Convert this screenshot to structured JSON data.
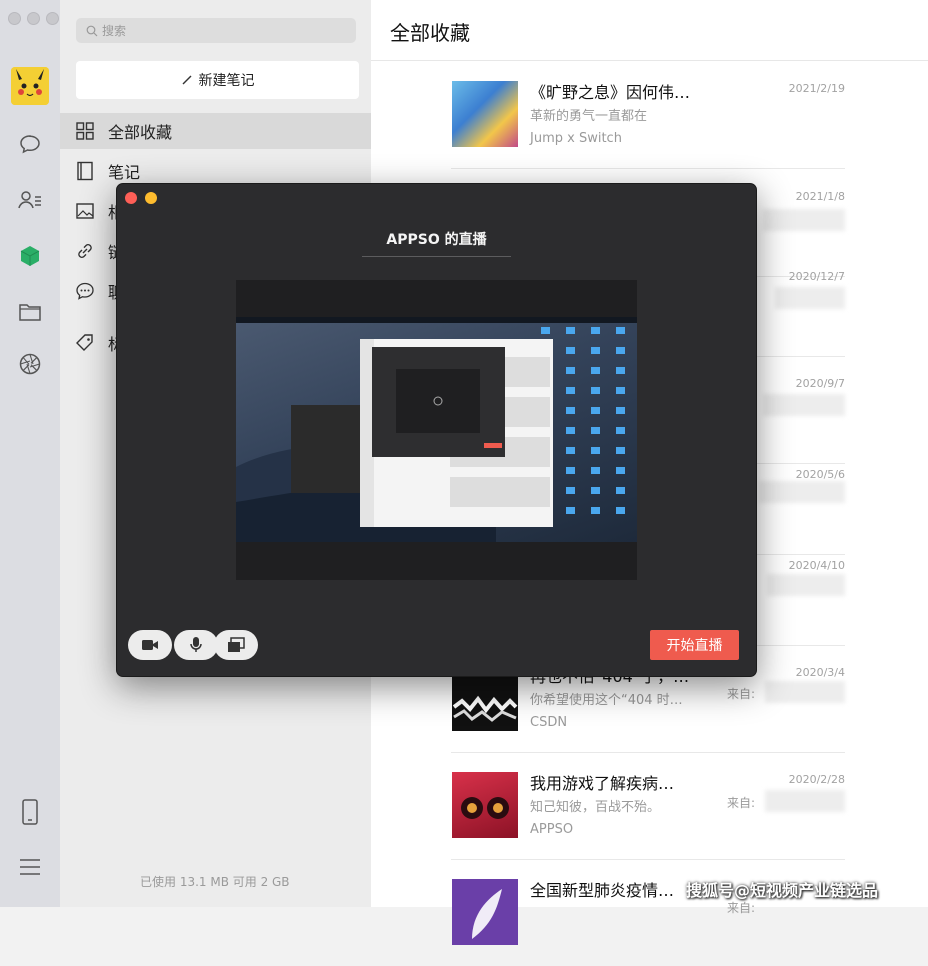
{
  "sidebar": {
    "search_placeholder": "搜索",
    "new_note_label": "新建笔记",
    "items": [
      {
        "label": "全部收藏",
        "icon": "grid-icon"
      },
      {
        "label": "笔记",
        "icon": "notebook-icon"
      },
      {
        "label": "相",
        "icon": "image-icon"
      },
      {
        "label": "链",
        "icon": "link-icon"
      },
      {
        "label": "聊",
        "icon": "chat-icon"
      },
      {
        "label": "标",
        "icon": "tag-icon"
      }
    ],
    "storage_text": "已使用 13.1 MB 可用 2 GB"
  },
  "main": {
    "title": "全部收藏",
    "items": [
      {
        "title": "《旷野之息》因何伟…",
        "subtitle": "革新的勇气一直都在",
        "source": "Jump x Switch",
        "date": "2021/2/19",
        "from": ""
      },
      {
        "title": "",
        "subtitle": "",
        "source": "",
        "date": "2021/1/8",
        "from": ""
      },
      {
        "title": "",
        "subtitle": "",
        "source": "",
        "date": "2020/12/7",
        "from": ""
      },
      {
        "title": "",
        "subtitle": "",
        "source": "",
        "date": "2020/9/7",
        "from": ""
      },
      {
        "title": "",
        "subtitle": "",
        "source": "",
        "date": "2020/5/6",
        "from": ""
      },
      {
        "title": "",
        "subtitle": "",
        "source": "",
        "date": "2020/4/10",
        "from": ""
      },
      {
        "title": "再也不怕“404”了，…",
        "subtitle": "你希望使用这个“404 时…",
        "source": "CSDN",
        "date": "2020/3/4",
        "from": "来自:"
      },
      {
        "title": "我用游戏了解疾病…",
        "subtitle": "知己知彼，百战不殆。",
        "source": "APPSO",
        "date": "2020/2/28",
        "from": "来自:"
      },
      {
        "title": "全国新型肺炎疫情…",
        "subtitle": "",
        "source": "",
        "date": "",
        "from": "来自:"
      }
    ]
  },
  "modal": {
    "title": "APPSO 的直播",
    "start_label": "开始直播",
    "controls": [
      "camera-icon",
      "microphone-icon",
      "screen-share-icon"
    ]
  },
  "watermark": "搜狐号@短视频产业链选品",
  "colors": {
    "accent": "#ef5b4e",
    "modal_bg": "#2c2c2e",
    "green": "#2aae67"
  }
}
